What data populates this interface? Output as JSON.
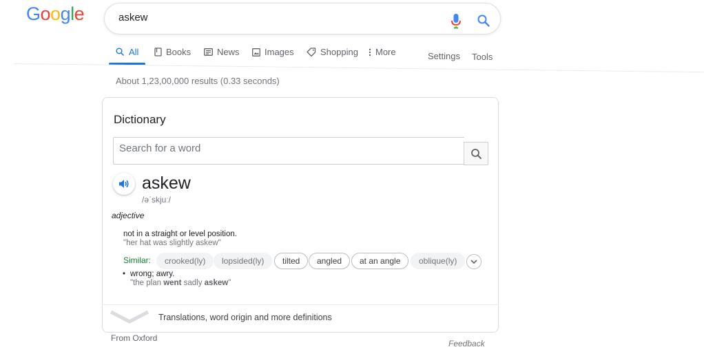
{
  "logo": {
    "letters": [
      "G",
      "o",
      "o",
      "g",
      "l",
      "e"
    ],
    "colors": [
      "#4285F4",
      "#EA4335",
      "#FBBC05",
      "#4285F4",
      "#34A853",
      "#EA4335"
    ]
  },
  "search": {
    "query": "askew",
    "mic_icon": "microphone-icon",
    "search_icon": "magnifier-icon"
  },
  "tabs": {
    "all": "All",
    "books": "Books",
    "news": "News",
    "images": "Images",
    "shopping": "Shopping",
    "more": "More",
    "settings": "Settings",
    "tools": "Tools"
  },
  "results": {
    "stats": "About 1,23,00,000 results (0.33 seconds)"
  },
  "dictionary": {
    "title": "Dictionary",
    "search_placeholder": "Search for a word",
    "headword": "askew",
    "pronunciation": "/əˈskjuː/",
    "part_of_speech": "adjective",
    "sense1": {
      "definition": "not in a straight or level position.",
      "example": "\"her hat was slightly askew\""
    },
    "similar_label": "Similar:",
    "similar": [
      {
        "text": "crooked(ly)",
        "style": "plain"
      },
      {
        "text": "lopsided(ly)",
        "style": "plain"
      },
      {
        "text": "tilted",
        "style": "outlined"
      },
      {
        "text": "angled",
        "style": "outlined"
      },
      {
        "text": "at an angle",
        "style": "outlined"
      },
      {
        "text": "oblique(ly)",
        "style": "plain"
      }
    ],
    "sense2": {
      "definition": "wrong; awry.",
      "example_pre": "\"the plan ",
      "example_b1": "went",
      "example_mid": " sadly ",
      "example_b2": "askew",
      "example_post": "\""
    },
    "more_defs": "Translations, word origin and more definitions",
    "source": "From Oxford",
    "feedback": "Feedback"
  },
  "colors": {
    "accent": "#1a73e8",
    "similar_green": "#188038"
  }
}
